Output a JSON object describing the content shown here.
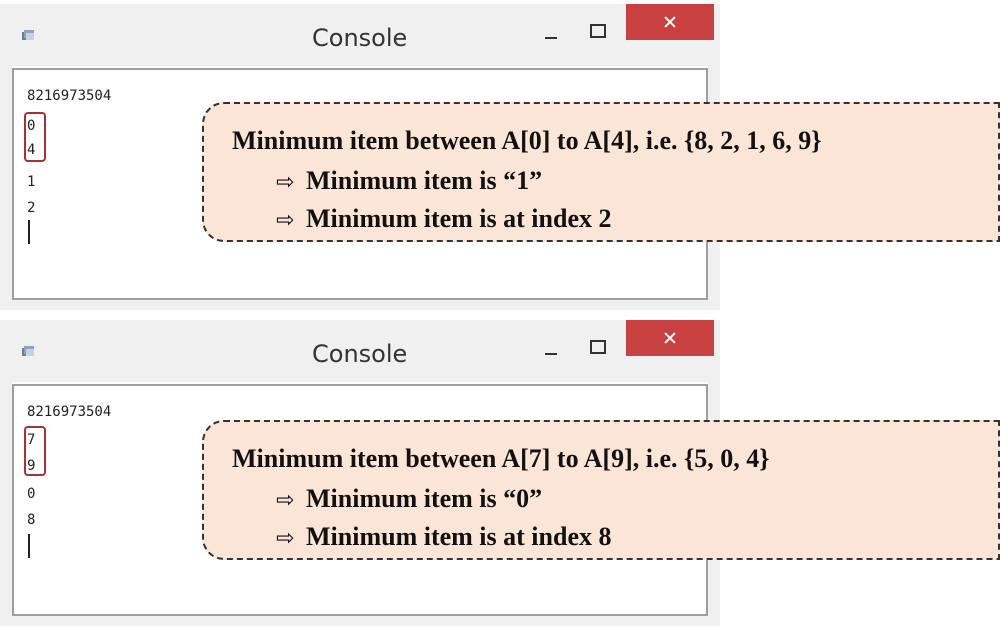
{
  "windows": [
    {
      "title": "Console",
      "output_lines": [
        "8216973504",
        "0",
        "4",
        "1",
        "2"
      ],
      "callout": {
        "heading": "Minimum item between A[0] to A[4], i.e. {8, 2, 1, 6, 9}",
        "bullets": [
          "Minimum item is “1”",
          "Minimum item is at index 2"
        ]
      }
    },
    {
      "title": "Console",
      "output_lines": [
        "8216973504",
        "7",
        "9",
        "0",
        "8"
      ],
      "callout": {
        "heading": "Minimum item between A[7] to A[9], i.e. {5, 0, 4}",
        "bullets": [
          "Minimum item is “0”",
          "Minimum item is at index 8"
        ]
      }
    }
  ],
  "icons": {
    "app": "console-app-icon",
    "minimize": "minimize-icon",
    "maximize": "maximize-icon",
    "close": "close-icon",
    "bullet_arrow": "⇨"
  },
  "colors": {
    "close_button": "#c8403f",
    "callout_fill": "#fbe5d6",
    "highlight_border": "#a83232"
  }
}
